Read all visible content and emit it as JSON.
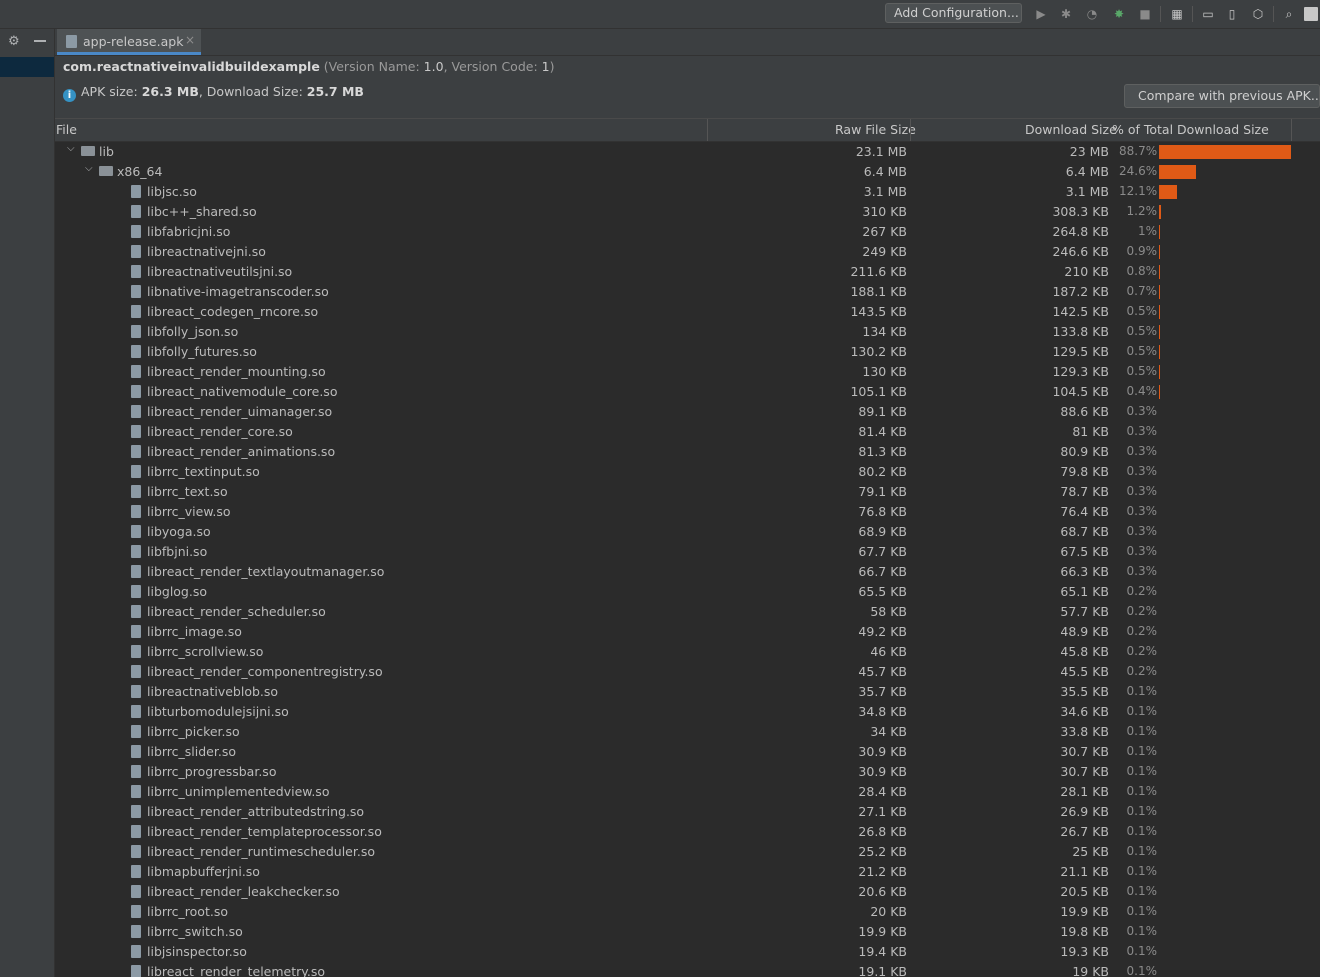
{
  "toolbar": {
    "add_configuration_label": "Add Configuration..."
  },
  "tab": {
    "label": "app-release.apk",
    "close": "×"
  },
  "header": {
    "package_name": "com.reactnativeinvalidbuildexample",
    "version_prefix": " (Version Name: ",
    "version_name": "1.0",
    "version_mid": ", Version Code: ",
    "version_code": "1",
    "version_suffix": ")",
    "apk_size_label": "APK size: ",
    "apk_size": "26.3 MB",
    "download_size_label": ", Download Size: ",
    "download_size": "25.7 MB",
    "compare_button": "Compare with previous APK..."
  },
  "table": {
    "columns": {
      "file": "File",
      "raw": "Raw File Size",
      "download": "Download Size",
      "percent": "% of Total Download Size"
    },
    "rows": [
      {
        "name": "lib",
        "raw": "23.1 MB",
        "dl": "23 MB",
        "pct": "88.7%",
        "pct_value": 88.7,
        "level": 0,
        "type": "folder"
      },
      {
        "name": "x86_64",
        "raw": "6.4 MB",
        "dl": "6.4 MB",
        "pct": "24.6%",
        "pct_value": 24.6,
        "level": 1,
        "type": "folder"
      },
      {
        "name": "libjsc.so",
        "raw": "3.1 MB",
        "dl": "3.1 MB",
        "pct": "12.1%",
        "pct_value": 12.1,
        "level": 2,
        "type": "file"
      },
      {
        "name": "libc++_shared.so",
        "raw": "310 KB",
        "dl": "308.3 KB",
        "pct": "1.2%",
        "pct_value": 1.2,
        "level": 2,
        "type": "file"
      },
      {
        "name": "libfabricjni.so",
        "raw": "267 KB",
        "dl": "264.8 KB",
        "pct": "1%",
        "pct_value": 1.0,
        "level": 2,
        "type": "file"
      },
      {
        "name": "libreactnativejni.so",
        "raw": "249 KB",
        "dl": "246.6 KB",
        "pct": "0.9%",
        "pct_value": 0.9,
        "level": 2,
        "type": "file"
      },
      {
        "name": "libreactnativeutilsjni.so",
        "raw": "211.6 KB",
        "dl": "210 KB",
        "pct": "0.8%",
        "pct_value": 0.8,
        "level": 2,
        "type": "file"
      },
      {
        "name": "libnative-imagetranscoder.so",
        "raw": "188.1 KB",
        "dl": "187.2 KB",
        "pct": "0.7%",
        "pct_value": 0.7,
        "level": 2,
        "type": "file"
      },
      {
        "name": "libreact_codegen_rncore.so",
        "raw": "143.5 KB",
        "dl": "142.5 KB",
        "pct": "0.5%",
        "pct_value": 0.5,
        "level": 2,
        "type": "file"
      },
      {
        "name": "libfolly_json.so",
        "raw": "134 KB",
        "dl": "133.8 KB",
        "pct": "0.5%",
        "pct_value": 0.5,
        "level": 2,
        "type": "file"
      },
      {
        "name": "libfolly_futures.so",
        "raw": "130.2 KB",
        "dl": "129.5 KB",
        "pct": "0.5%",
        "pct_value": 0.5,
        "level": 2,
        "type": "file"
      },
      {
        "name": "libreact_render_mounting.so",
        "raw": "130 KB",
        "dl": "129.3 KB",
        "pct": "0.5%",
        "pct_value": 0.5,
        "level": 2,
        "type": "file"
      },
      {
        "name": "libreact_nativemodule_core.so",
        "raw": "105.1 KB",
        "dl": "104.5 KB",
        "pct": "0.4%",
        "pct_value": 0.4,
        "level": 2,
        "type": "file"
      },
      {
        "name": "libreact_render_uimanager.so",
        "raw": "89.1 KB",
        "dl": "88.6 KB",
        "pct": "0.3%",
        "pct_value": 0.3,
        "level": 2,
        "type": "file"
      },
      {
        "name": "libreact_render_core.so",
        "raw": "81.4 KB",
        "dl": "81 KB",
        "pct": "0.3%",
        "pct_value": 0.3,
        "level": 2,
        "type": "file"
      },
      {
        "name": "libreact_render_animations.so",
        "raw": "81.3 KB",
        "dl": "80.9 KB",
        "pct": "0.3%",
        "pct_value": 0.3,
        "level": 2,
        "type": "file"
      },
      {
        "name": "librrc_textinput.so",
        "raw": "80.2 KB",
        "dl": "79.8 KB",
        "pct": "0.3%",
        "pct_value": 0.3,
        "level": 2,
        "type": "file"
      },
      {
        "name": "librrc_text.so",
        "raw": "79.1 KB",
        "dl": "78.7 KB",
        "pct": "0.3%",
        "pct_value": 0.3,
        "level": 2,
        "type": "file"
      },
      {
        "name": "librrc_view.so",
        "raw": "76.8 KB",
        "dl": "76.4 KB",
        "pct": "0.3%",
        "pct_value": 0.3,
        "level": 2,
        "type": "file"
      },
      {
        "name": "libyoga.so",
        "raw": "68.9 KB",
        "dl": "68.7 KB",
        "pct": "0.3%",
        "pct_value": 0.3,
        "level": 2,
        "type": "file"
      },
      {
        "name": "libfbjni.so",
        "raw": "67.7 KB",
        "dl": "67.5 KB",
        "pct": "0.3%",
        "pct_value": 0.3,
        "level": 2,
        "type": "file"
      },
      {
        "name": "libreact_render_textlayoutmanager.so",
        "raw": "66.7 KB",
        "dl": "66.3 KB",
        "pct": "0.3%",
        "pct_value": 0.3,
        "level": 2,
        "type": "file"
      },
      {
        "name": "libglog.so",
        "raw": "65.5 KB",
        "dl": "65.1 KB",
        "pct": "0.2%",
        "pct_value": 0.2,
        "level": 2,
        "type": "file"
      },
      {
        "name": "libreact_render_scheduler.so",
        "raw": "58 KB",
        "dl": "57.7 KB",
        "pct": "0.2%",
        "pct_value": 0.2,
        "level": 2,
        "type": "file"
      },
      {
        "name": "librrc_image.so",
        "raw": "49.2 KB",
        "dl": "48.9 KB",
        "pct": "0.2%",
        "pct_value": 0.2,
        "level": 2,
        "type": "file"
      },
      {
        "name": "librrc_scrollview.so",
        "raw": "46 KB",
        "dl": "45.8 KB",
        "pct": "0.2%",
        "pct_value": 0.2,
        "level": 2,
        "type": "file"
      },
      {
        "name": "libreact_render_componentregistry.so",
        "raw": "45.7 KB",
        "dl": "45.5 KB",
        "pct": "0.2%",
        "pct_value": 0.2,
        "level": 2,
        "type": "file"
      },
      {
        "name": "libreactnativeblob.so",
        "raw": "35.7 KB",
        "dl": "35.5 KB",
        "pct": "0.1%",
        "pct_value": 0.1,
        "level": 2,
        "type": "file"
      },
      {
        "name": "libturbomodulejsijni.so",
        "raw": "34.8 KB",
        "dl": "34.6 KB",
        "pct": "0.1%",
        "pct_value": 0.1,
        "level": 2,
        "type": "file"
      },
      {
        "name": "librrc_picker.so",
        "raw": "34 KB",
        "dl": "33.8 KB",
        "pct": "0.1%",
        "pct_value": 0.1,
        "level": 2,
        "type": "file"
      },
      {
        "name": "librrc_slider.so",
        "raw": "30.9 KB",
        "dl": "30.7 KB",
        "pct": "0.1%",
        "pct_value": 0.1,
        "level": 2,
        "type": "file"
      },
      {
        "name": "librrc_progressbar.so",
        "raw": "30.9 KB",
        "dl": "30.7 KB",
        "pct": "0.1%",
        "pct_value": 0.1,
        "level": 2,
        "type": "file"
      },
      {
        "name": "librrc_unimplementedview.so",
        "raw": "28.4 KB",
        "dl": "28.1 KB",
        "pct": "0.1%",
        "pct_value": 0.1,
        "level": 2,
        "type": "file"
      },
      {
        "name": "libreact_render_attributedstring.so",
        "raw": "27.1 KB",
        "dl": "26.9 KB",
        "pct": "0.1%",
        "pct_value": 0.1,
        "level": 2,
        "type": "file"
      },
      {
        "name": "libreact_render_templateprocessor.so",
        "raw": "26.8 KB",
        "dl": "26.7 KB",
        "pct": "0.1%",
        "pct_value": 0.1,
        "level": 2,
        "type": "file"
      },
      {
        "name": "libreact_render_runtimescheduler.so",
        "raw": "25.2 KB",
        "dl": "25 KB",
        "pct": "0.1%",
        "pct_value": 0.1,
        "level": 2,
        "type": "file"
      },
      {
        "name": "libmapbufferjni.so",
        "raw": "21.2 KB",
        "dl": "21.1 KB",
        "pct": "0.1%",
        "pct_value": 0.1,
        "level": 2,
        "type": "file"
      },
      {
        "name": "libreact_render_leakchecker.so",
        "raw": "20.6 KB",
        "dl": "20.5 KB",
        "pct": "0.1%",
        "pct_value": 0.1,
        "level": 2,
        "type": "file"
      },
      {
        "name": "librrc_root.so",
        "raw": "20 KB",
        "dl": "19.9 KB",
        "pct": "0.1%",
        "pct_value": 0.1,
        "level": 2,
        "type": "file"
      },
      {
        "name": "librrc_switch.so",
        "raw": "19.9 KB",
        "dl": "19.8 KB",
        "pct": "0.1%",
        "pct_value": 0.1,
        "level": 2,
        "type": "file"
      },
      {
        "name": "libjsinspector.so",
        "raw": "19.4 KB",
        "dl": "19.3 KB",
        "pct": "0.1%",
        "pct_value": 0.1,
        "level": 2,
        "type": "file"
      },
      {
        "name": "libreact_render_telemetry.so",
        "raw": "19.1 KB",
        "dl": "19 KB",
        "pct": "0.1%",
        "pct_value": 0.1,
        "level": 2,
        "type": "file"
      }
    ]
  },
  "colors": {
    "bar": "#e05a16",
    "selection": "#0d293e",
    "accent_tab": "#4a88c7"
  },
  "icons": {
    "toolbar": [
      "run-icon",
      "debug-icon",
      "coverage-icon",
      "profile-icon",
      "stop-icon",
      "project-structure-icon",
      "terminal-icon",
      "device-manager-icon",
      "sdk-manager-icon",
      "search-icon",
      "avatar-icon"
    ]
  }
}
